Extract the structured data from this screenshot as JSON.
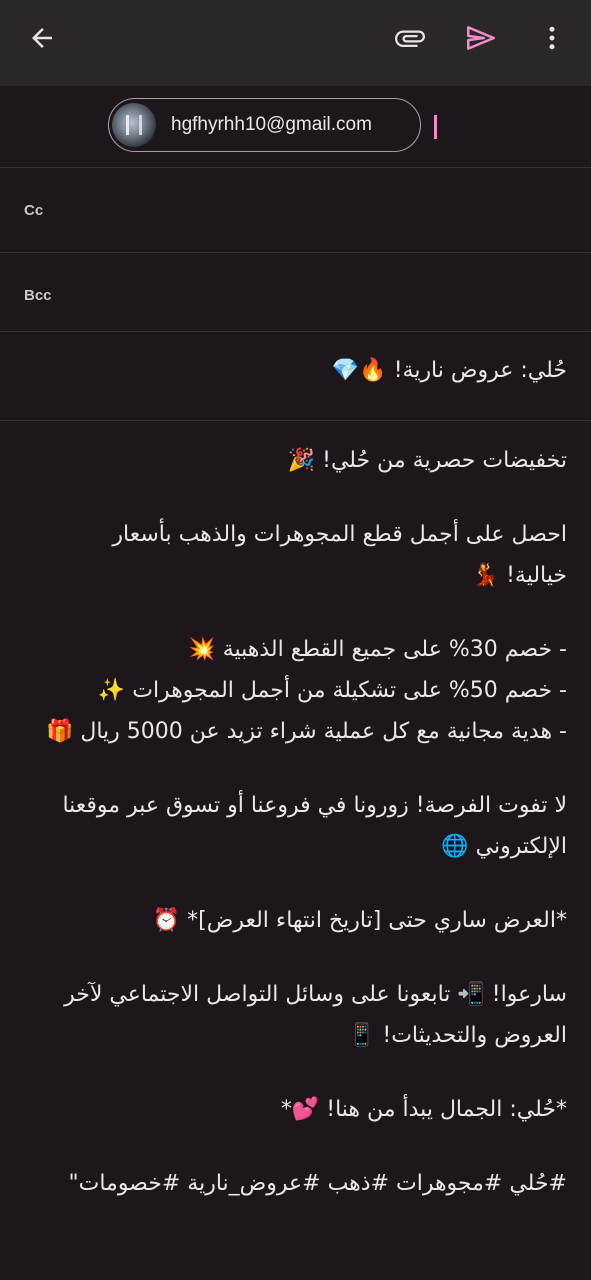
{
  "toolbar": {
    "back_icon": "arrow-left-icon",
    "attach_icon": "paperclip-icon",
    "send_icon": "send-icon",
    "more_icon": "more-vert-icon",
    "accent": "#f08fc7"
  },
  "recipients": {
    "to_chip": "hgfhyrhh10@gmail.com"
  },
  "fields": {
    "cc_label": "Cc",
    "bcc_label": "Bcc"
  },
  "subject": "حُلي: عروض نارية! 🔥💎",
  "body": {
    "line1": "تخفيضات حصرية من حُلي! 🎉",
    "line2a": "احصل على أجمل قطع المجوهرات والذهب بأسعار",
    "line2b": "خيالية! 💃",
    "bullet1": "- خصم 30% على جميع القطع الذهبية 💥",
    "bullet2": "- خصم 50% على تشكيلة من أجمل المجوهرات ✨",
    "bullet3": "- هدية مجانية مع كل عملية شراء تزيد عن 5000 ريال 🎁",
    "line4a": "لا تفوت الفرصة! زورونا في فروعنا أو تسوق عبر موقعنا",
    "line4b": "الإلكتروني 🌐",
    "line5": "*العرض ساري حتى [تاريخ انتهاء العرض]* ⏰",
    "line6a": "سارعوا! 📲 تابعونا على وسائل التواصل الاجتماعي لآخر",
    "line6b": "العروض والتحديثات! 📱",
    "line7": "*حُلي: الجمال يبدأ من هنا! 💕*",
    "line8": "#حُلي #مجوهرات #ذهب #عروض_نارية #خصومات\""
  }
}
